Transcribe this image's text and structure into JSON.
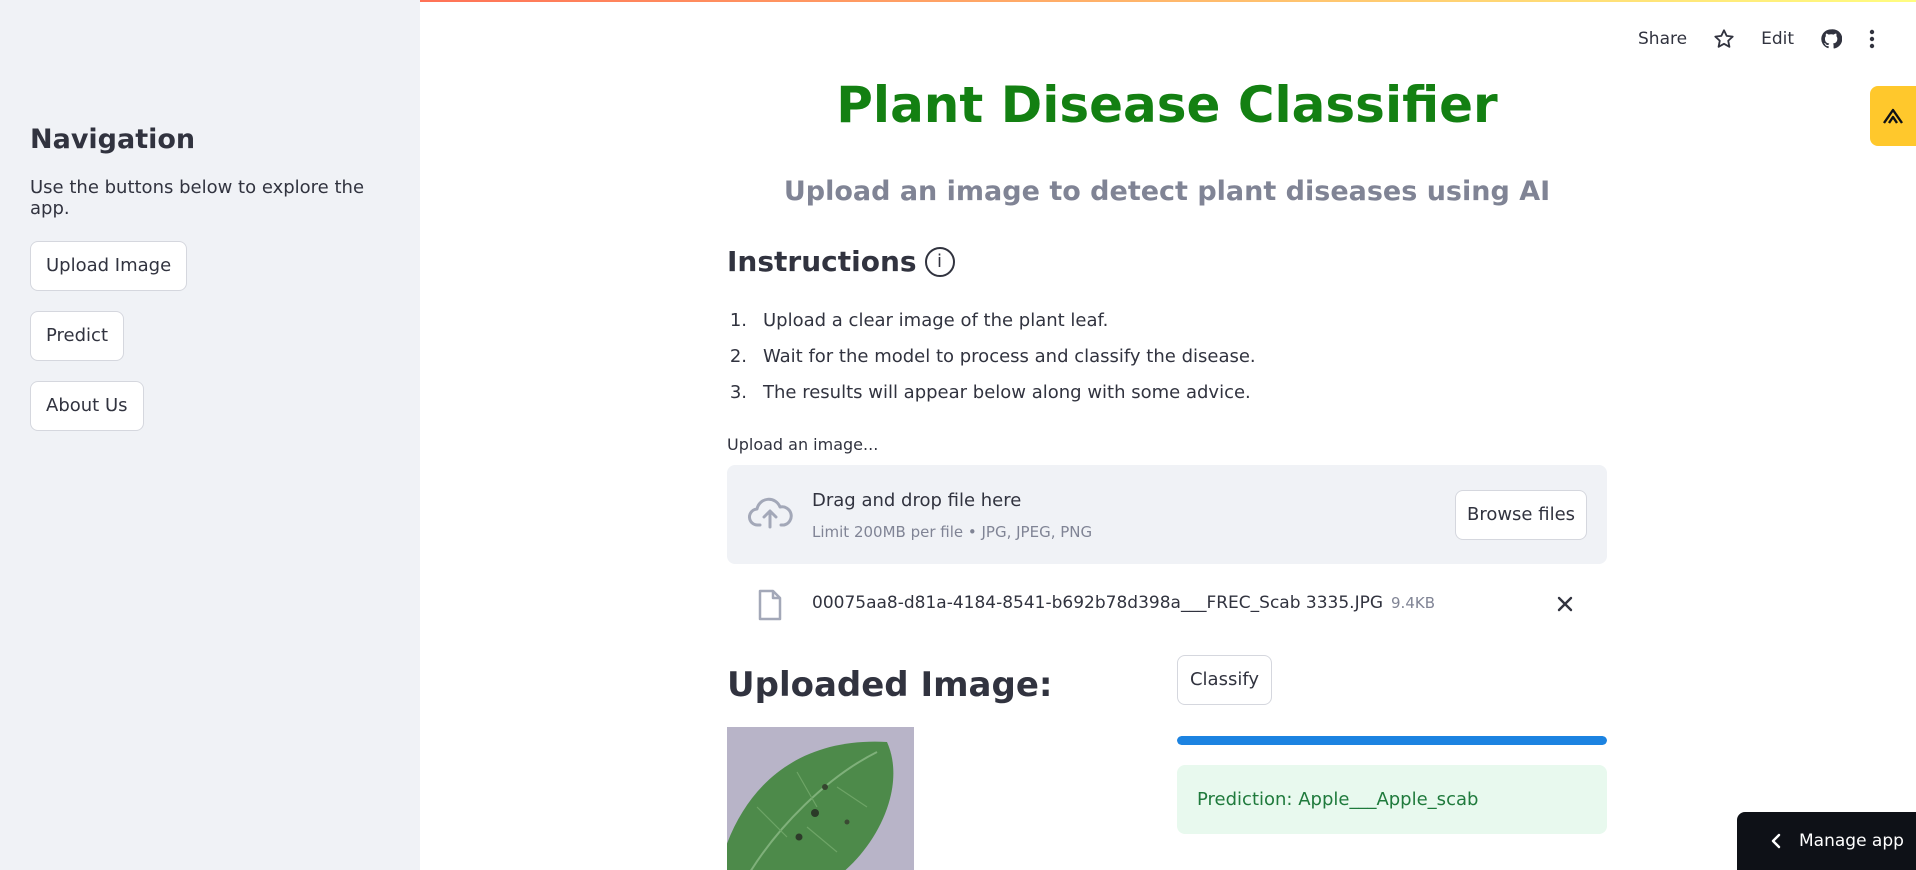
{
  "sidebar": {
    "heading": "Navigation",
    "description": "Use the buttons below to explore the app.",
    "buttons": [
      {
        "label": "Upload Image"
      },
      {
        "label": "Predict"
      },
      {
        "label": "About Us"
      }
    ]
  },
  "toolbar": {
    "share_label": "Share",
    "edit_label": "Edit",
    "icons": [
      "star-icon",
      "github-icon",
      "more-vert-icon"
    ]
  },
  "main": {
    "title": "Plant Disease Classifier",
    "subtitle": "Upload an image to detect plant diseases using AI",
    "instructions_heading": "Instructions",
    "instructions_icon": "ⓘ",
    "steps": [
      {
        "num": "1.",
        "text": "Upload a clear image of the plant leaf."
      },
      {
        "num": "2.",
        "text": "Wait for the model to process and classify the disease."
      },
      {
        "num": "3.",
        "text": "The results will appear below along with some advice."
      }
    ],
    "uploader": {
      "label": "Upload an image...",
      "drop_title": "Drag and drop file here",
      "limit_text": "Limit 200MB per file • JPG, JPEG, PNG",
      "browse_label": "Browse files"
    },
    "file": {
      "name": "00075aa8-d81a-4184-8541-b692b78d398a___FREC_Scab 3335.JPG",
      "size": "9.4KB"
    },
    "uploaded_heading": "Uploaded Image:",
    "classify_label": "Classify",
    "progress": 1.0,
    "prediction_text": "Prediction: Apple___Apple_scab"
  },
  "manage_app_label": "Manage app",
  "colors": {
    "title_green": "#138012",
    "accent_blue": "#1c83e1",
    "sidebar_bg": "#f0f2f6",
    "success_bg": "#e8f9ee",
    "badge_yellow": "#ffc82c"
  }
}
